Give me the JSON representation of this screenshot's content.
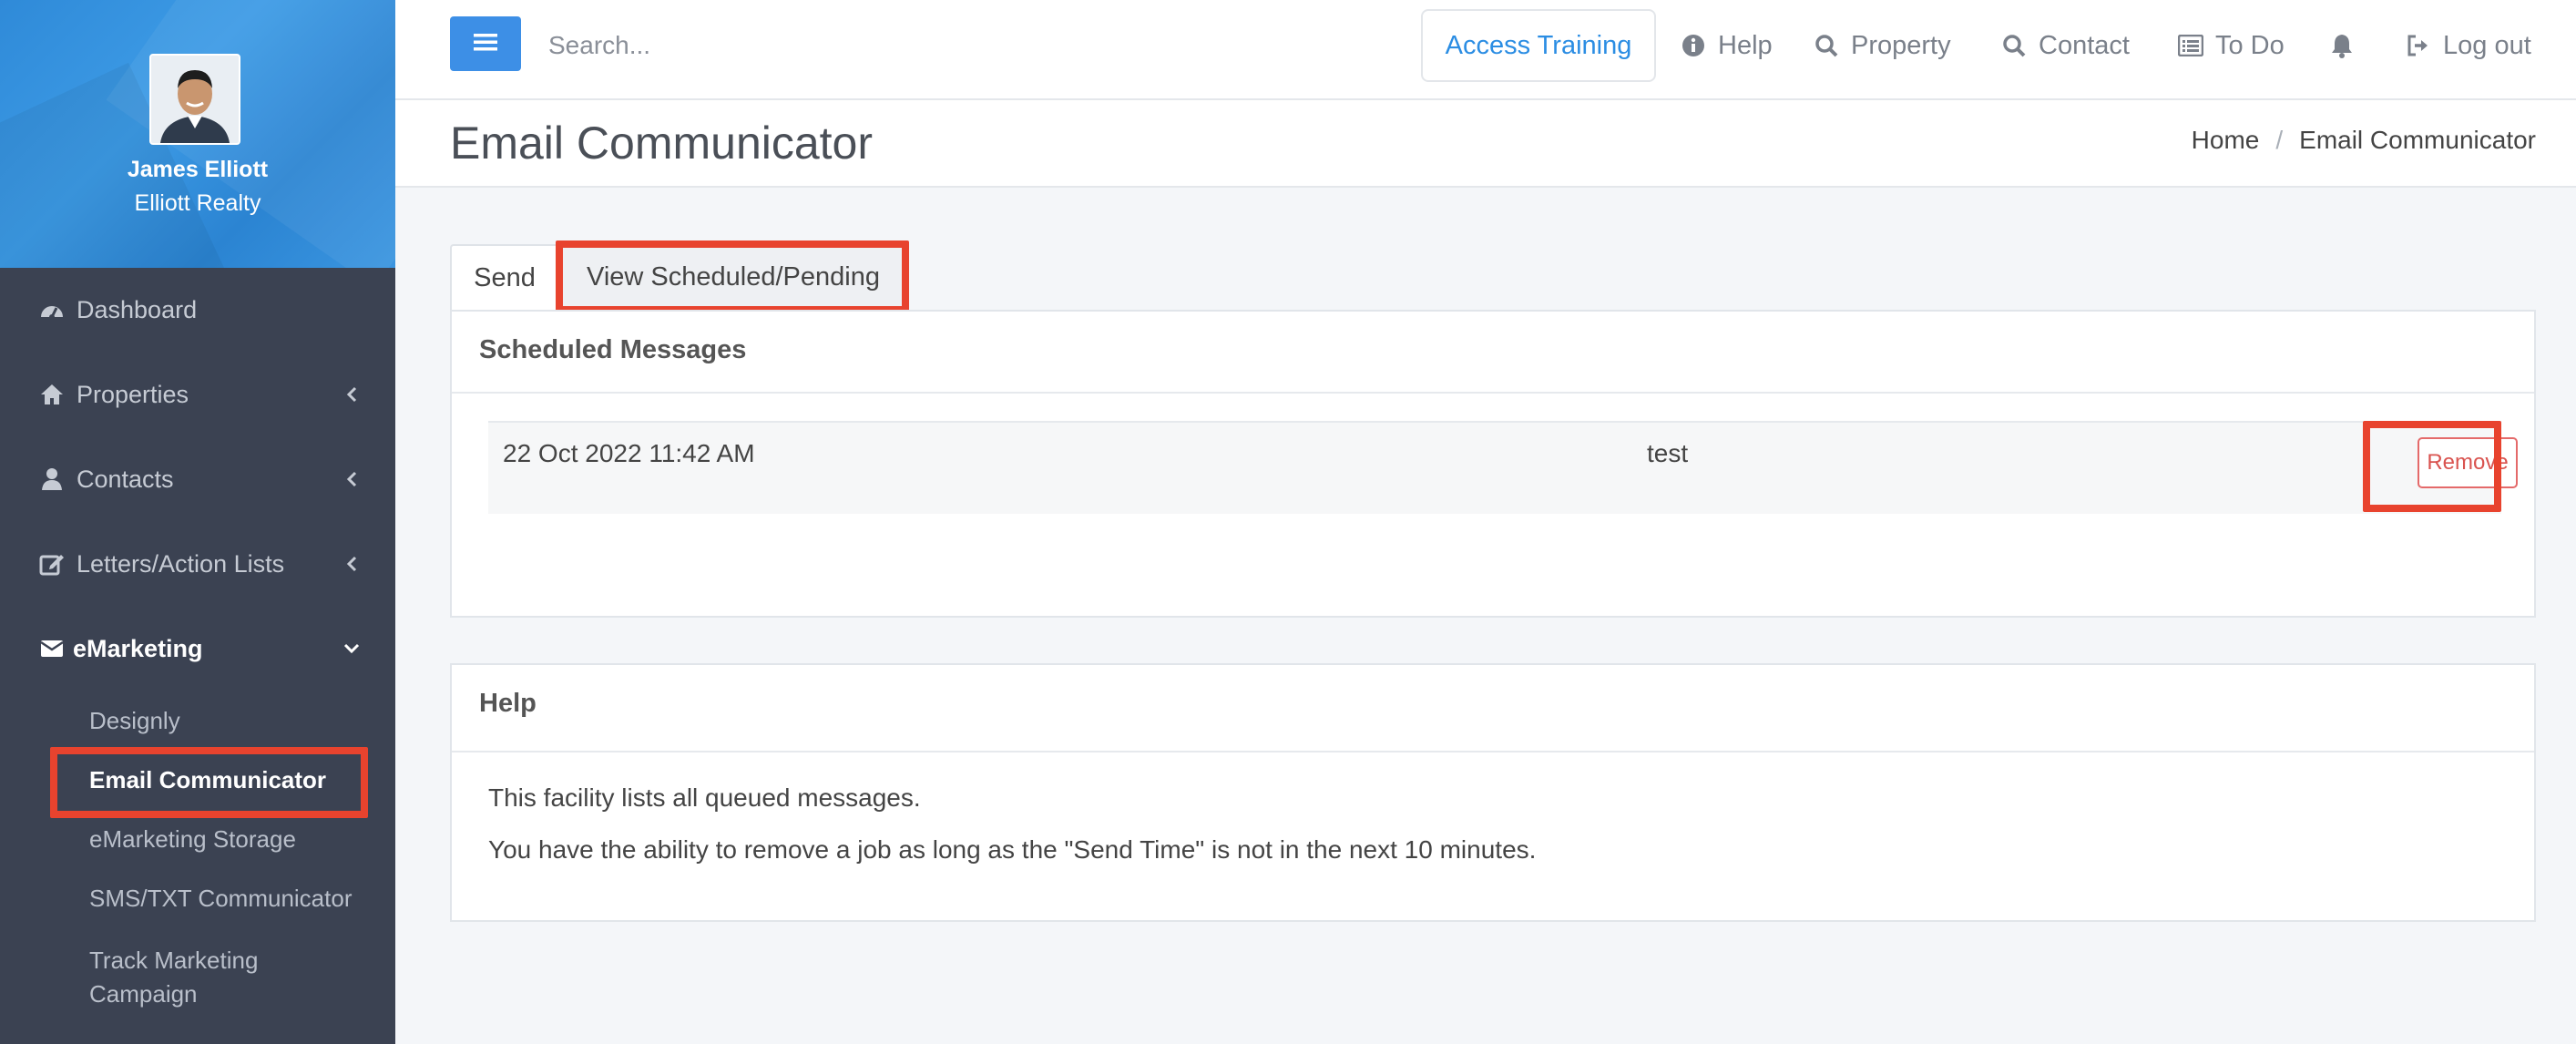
{
  "sidebar": {
    "user_name": "James Elliott",
    "user_company": "Elliott Realty",
    "items": [
      {
        "label": "Dashboard"
      },
      {
        "label": "Properties"
      },
      {
        "label": "Contacts"
      },
      {
        "label": "Letters/Action Lists"
      },
      {
        "label": "eMarketing"
      }
    ],
    "subitems": [
      {
        "label": "Designly"
      },
      {
        "label": "Email Communicator"
      },
      {
        "label": "eMarketing Storage"
      },
      {
        "label": "SMS/TXT Communicator"
      },
      {
        "label": "Track Marketing Campaign"
      }
    ]
  },
  "topbar": {
    "search_placeholder": "Search...",
    "access_training": "Access Training",
    "links": [
      {
        "label": "Help",
        "icon": "info-circle-icon"
      },
      {
        "label": "Property",
        "icon": "search-icon"
      },
      {
        "label": "Contact",
        "icon": "search-icon"
      },
      {
        "label": "To Do",
        "icon": "list-icon"
      },
      {
        "label": "",
        "icon": "bell-icon"
      },
      {
        "label": "Log out",
        "icon": "sign-out-icon"
      }
    ]
  },
  "header": {
    "title": "Email Communicator",
    "breadcrumb": [
      "Home",
      "/",
      "Email Communicator"
    ]
  },
  "tabs": [
    {
      "label": "Send"
    },
    {
      "label": "View Scheduled/Pending"
    }
  ],
  "scheduled": {
    "title": "Scheduled Messages",
    "rows": [
      {
        "date": "22 Oct 2022 11:42 AM",
        "subject": "test",
        "action": "Remove"
      }
    ]
  },
  "help": {
    "title": "Help",
    "lines": [
      "This facility lists all queued messages.",
      "You have the ability to remove a job as long as the \"Send Time\" is not in the next 10 minutes."
    ]
  },
  "colors": {
    "accent": "#3d8fe6",
    "highlight": "#e8432e",
    "sidebar": "#3b4252",
    "danger": "#d9534f"
  }
}
